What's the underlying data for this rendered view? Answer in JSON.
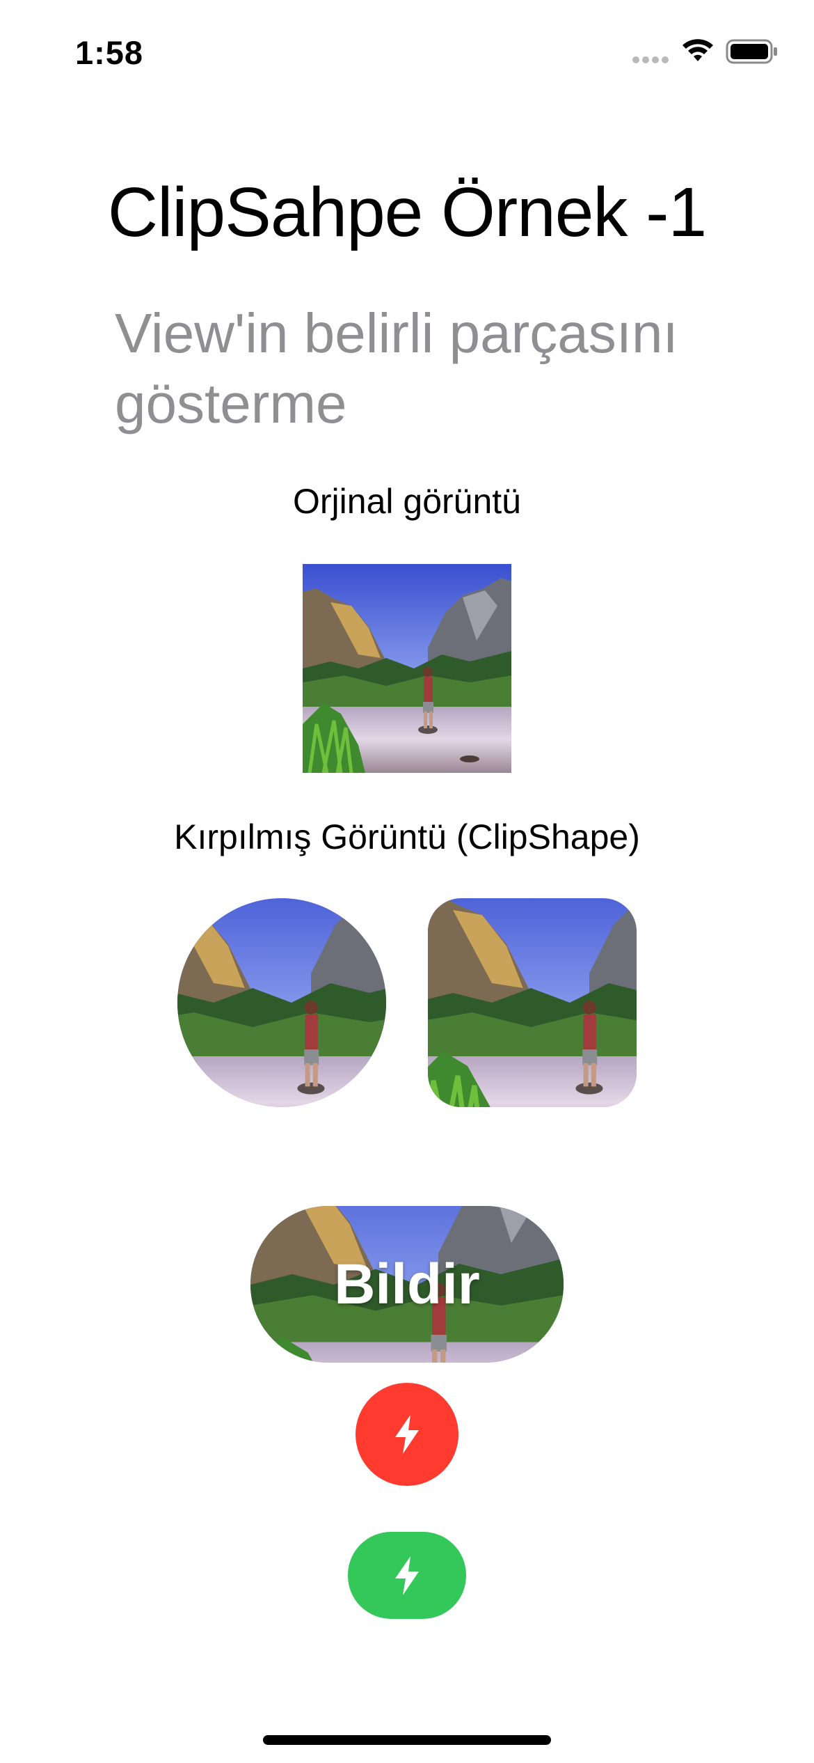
{
  "status_bar": {
    "time": "1:58"
  },
  "title": "ClipSahpe Örnek -1",
  "subtitle": "View'in belirli parçasını gösterme",
  "sections": {
    "original_label": "Orjinal görüntü",
    "clipped_label": "Kırpılmış Görüntü (ClipShape)"
  },
  "buttons": {
    "bildir_label": "Bildir",
    "red_icon": "bolt-icon",
    "green_icon": "bolt-icon"
  },
  "colors": {
    "red": "#ff3b30",
    "green": "#34c759",
    "subtitle_gray": "#8e8e93"
  }
}
